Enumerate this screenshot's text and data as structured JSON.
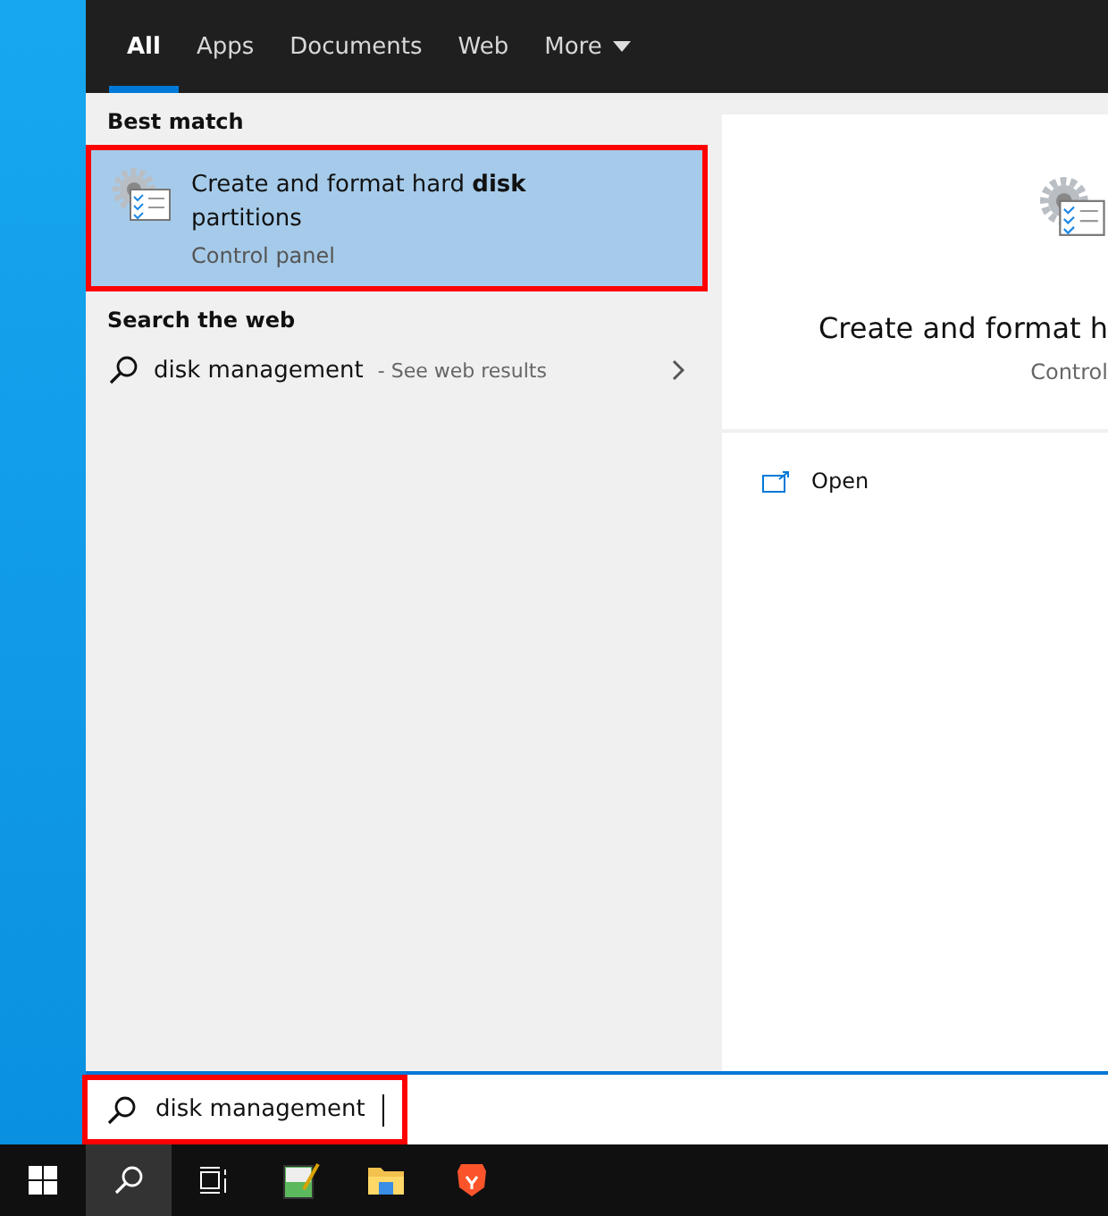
{
  "tabs": [
    {
      "label": "All",
      "selected": true,
      "dropdown": false
    },
    {
      "label": "Apps",
      "selected": false,
      "dropdown": false
    },
    {
      "label": "Documents",
      "selected": false,
      "dropdown": false
    },
    {
      "label": "Web",
      "selected": false,
      "dropdown": false
    },
    {
      "label": "More",
      "selected": false,
      "dropdown": true
    }
  ],
  "best_match": {
    "heading": "Best match",
    "title": "Create and format hard **disk** partitions",
    "subtitle": "Control panel",
    "selected": true
  },
  "web": {
    "heading": "Search the web",
    "query": "disk management",
    "hint": "- See web results"
  },
  "detail": {
    "title": "Create and format h",
    "subtitle": "Control",
    "actions": [
      {
        "label": "Open"
      }
    ]
  },
  "search": {
    "value": "disk management"
  },
  "taskbar": [
    {
      "kind": "start",
      "selected": false
    },
    {
      "kind": "search",
      "selected": true
    },
    {
      "kind": "taskview",
      "selected": false
    },
    {
      "kind": "notepad",
      "selected": false
    },
    {
      "kind": "folder",
      "selected": false
    },
    {
      "kind": "browser",
      "selected": false
    }
  ]
}
